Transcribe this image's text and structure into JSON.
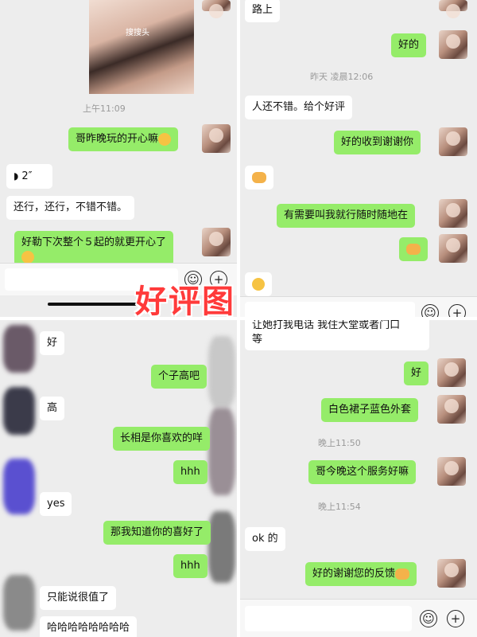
{
  "overlay_title": "好评图",
  "panel_tl": {
    "photo_tag": "搜搜头",
    "time1": "上午11:09",
    "msg_out1": "哥昨晚玩的开心嘛",
    "voice": "2″",
    "msg_in1": "还行，还行，不错不错。",
    "msg_out2": "好勒下次整个５起的就更开心了"
  },
  "panel_tr": {
    "msg_in0": "路上",
    "msg_out1": "好的",
    "time1": "昨天 凌晨12:06",
    "msg_in1": "人还不错。给个好评",
    "msg_out2": "好的收到谢谢你",
    "msg_out3": "有需要叫我就行随时随地在"
  },
  "panel_bl": {
    "msg_in1": "好",
    "msg_out1": "个子高吧",
    "msg_in2": "高",
    "msg_out2": "长相是你喜欢的咩",
    "msg_out3": "hhh",
    "msg_in3": "yes",
    "msg_out4": "那我知道你的喜好了",
    "msg_out5": "hhh",
    "msg_in4": "只能说很值了",
    "msg_in5": "哈哈哈哈哈哈哈哈"
  },
  "panel_br": {
    "msg_in0": "让她打我电话 我住大堂或者门口",
    "msg_in0b": "等",
    "msg_out1": "好",
    "msg_out2": "白色裙子蓝色外套",
    "time1": "晚上11:50",
    "msg_out3": "哥今晚这个服务好嘛",
    "time2": "晚上11:54",
    "msg_in1": "ok 的",
    "msg_out4": "好的谢谢您的反馈"
  },
  "icons": {
    "emoji_button": "smile-icon",
    "plus_button": "plus-icon"
  },
  "colors": {
    "bubble_out": "#95ec69",
    "bubble_in": "#ffffff",
    "chat_bg": "#ededed",
    "overlay_title": "#ff3a3a"
  }
}
